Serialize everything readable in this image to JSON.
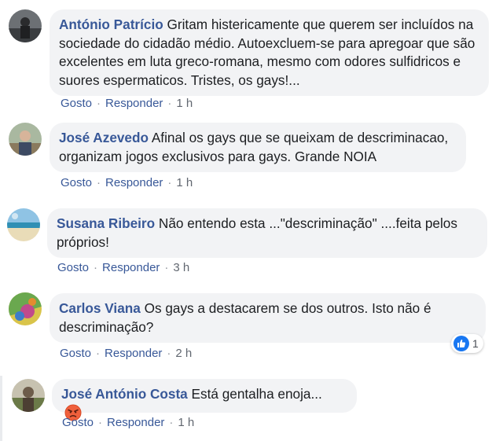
{
  "comments": [
    {
      "author": "António Patrício",
      "text": "Gritam histericamente que querem ser incluídos na sociedade do cidadão médio. Autoexcluem-se para apregoar que são excelentes em luta greco-romana, mesmo com odores sulfidricos e suores espermaticos. Tristes, os gays!...",
      "like_label": "Gosto",
      "reply_label": "Responder",
      "time": "1 h"
    },
    {
      "author": "José Azevedo",
      "text": "Afinal os gays que se queixam de descriminacao, organizam jogos exclusivos para gays. Grande NOIA",
      "like_label": "Gosto",
      "reply_label": "Responder",
      "time": "1 h"
    },
    {
      "author": "Susana Ribeiro",
      "text": "Não entendo esta ...\"descriminação\" ....feita pelos próprios!",
      "like_label": "Gosto",
      "reply_label": "Responder",
      "time": "3 h"
    },
    {
      "author": "Carlos Viana",
      "text": "Os gays a destacarem se dos outros. Isto não é descriminação?",
      "like_label": "Gosto",
      "reply_label": "Responder",
      "time": "2 h",
      "reaction_count": "1"
    },
    {
      "author": "José António Costa",
      "text": "Está gentalha enoja...",
      "like_label": "Gosto",
      "reply_label": "Responder",
      "time": "1 h"
    }
  ],
  "icons": {
    "like": "like-icon",
    "angry": "angry-emoji-icon"
  },
  "colors": {
    "author": "#385898",
    "bubble": "#f2f3f5",
    "like_blue": "#1877f2",
    "angry": "#f0603c"
  }
}
